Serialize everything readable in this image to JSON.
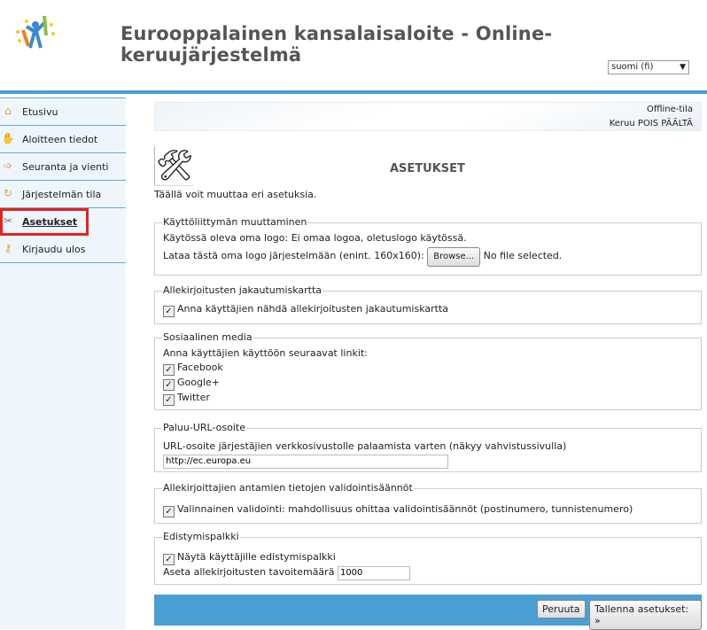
{
  "header": {
    "title": "Eurooppalainen kansalaisaloite - Online-keruujärjestelmä",
    "language": "suomi (fi)"
  },
  "sidebar": {
    "items": [
      {
        "label": "Etusivu",
        "icon": "home-icon"
      },
      {
        "label": "Aloitteen tiedot",
        "icon": "hands-icon"
      },
      {
        "label": "Seuranta ja vienti",
        "icon": "arrow-icon"
      },
      {
        "label": "Järjestelmän tila",
        "icon": "refresh-icon"
      },
      {
        "label": "Asetukset",
        "icon": "tools-icon",
        "active": true
      },
      {
        "label": "Kirjaudu ulos",
        "icon": "key-icon"
      }
    ]
  },
  "status": {
    "mode": "Offline-tila",
    "collection": "Keruu POIS PÄÄLTÄ"
  },
  "page": {
    "title": "ASETUKSET",
    "intro": "Täällä voit muuttaa eri asetuksia."
  },
  "ui": {
    "legend": "Käyttöliittymän muuttaminen",
    "current_logo": "Käytössä oleva oma logo: Ei omaa logoa, oletuslogo käytössä.",
    "upload_label": "Lataa tästä oma logo järjestelmään (enint. 160x160):",
    "browse": "Browse...",
    "no_file": "No file selected."
  },
  "map": {
    "legend": "Allekirjoitusten jakautumiskartta",
    "checkbox": "Anna käyttäjien nähdä allekirjoitusten jakautumiskartta",
    "checked": true
  },
  "social": {
    "legend": "Sosiaalinen media",
    "intro": "Anna käyttäjien käyttöön seuraavat linkit:",
    "items": [
      {
        "label": "Facebook",
        "checked": true
      },
      {
        "label": "Google+",
        "checked": true
      },
      {
        "label": "Twitter",
        "checked": true
      }
    ]
  },
  "return_url": {
    "legend": "Paluu-URL-osoite",
    "label": "URL-osoite järjestäjien verkkosivustolle palaamista varten (näkyy vahvistussivulla)",
    "value": "http://ec.europa.eu"
  },
  "validation": {
    "legend": "Allekirjoittajien antamien tietojen validointisäännöt",
    "checkbox": "Valinnainen validointi: mahdollisuus ohittaa validointisäännöt (postinumero, tunnistenumero)",
    "checked": true
  },
  "progress": {
    "legend": "Edistymispalkki",
    "checkbox": "Näytä käyttäjille edistymispalkki",
    "checked": true,
    "goal_label": "Aseta allekirjoitusten tavoitemäärä",
    "goal_value": "1000"
  },
  "footer": {
    "cancel": "Peruuta",
    "save": "Tallenna asetukset: »"
  },
  "colors": {
    "accent": "#4a9fd4",
    "highlight": "#e82020"
  }
}
